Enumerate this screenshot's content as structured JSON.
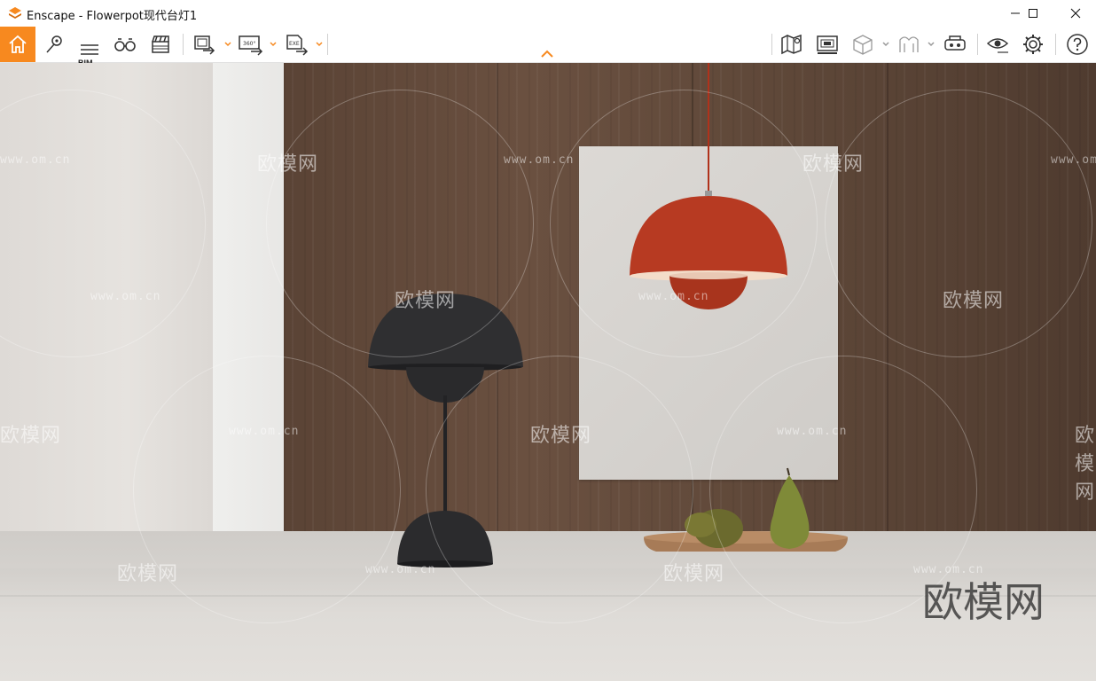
{
  "window": {
    "title": "Enscape - Flowerpot现代台灯1",
    "minimize_icon": "minimize-icon",
    "maximize_icon": "maximize-icon",
    "close_icon": "close-icon"
  },
  "toolbar": {
    "home_icon": "home-icon",
    "bim_label": "BIM",
    "left_icons": [
      "home-icon",
      "location-pin-icon",
      "bim-icon",
      "binoculars-icon",
      "clapperboard-icon",
      "batch-render-icon",
      "panorama-360-icon",
      "exe-export-icon"
    ],
    "badge_360": "360°",
    "badge_exe": "EXE",
    "right_icons": [
      "map-icon",
      "render-settings-icon",
      "box-icon",
      "material-icon",
      "vr-headset-icon",
      "eye-icon",
      "gear-icon",
      "help-icon"
    ],
    "accent": "#f7891f"
  },
  "viewport": {
    "watermark_text": "欧模网",
    "watermark_url": "www.om.cn",
    "watermark_big": "欧模网"
  }
}
